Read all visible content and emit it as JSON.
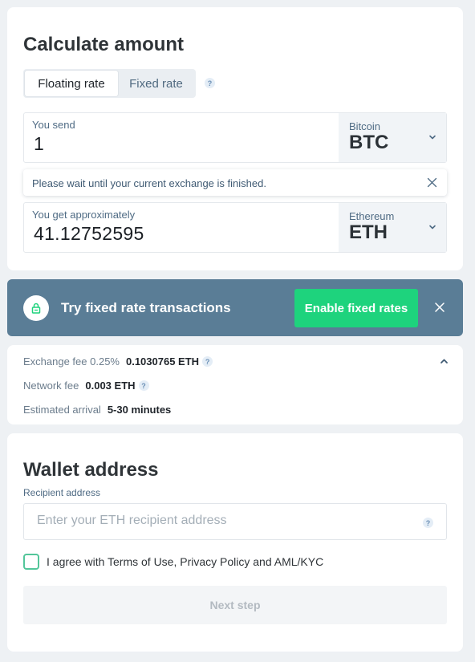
{
  "calculate": {
    "title": "Calculate amount",
    "tabs": [
      {
        "label": "Floating rate",
        "active": true
      },
      {
        "label": "Fixed rate",
        "active": false
      }
    ],
    "help_icon": "?",
    "send": {
      "label": "You send",
      "value": "1",
      "currency_name": "Bitcoin",
      "currency_code": "BTC"
    },
    "warning": "Please wait until your current exchange is finished.",
    "get": {
      "label": "You get approximately",
      "value": "41.12752595",
      "currency_name": "Ethereum",
      "currency_code": "ETH"
    }
  },
  "banner": {
    "text": "Try fixed rate transactions",
    "button_label": "Enable fixed rates",
    "icon": "lock-icon"
  },
  "fees": {
    "exchange_fee_label": "Exchange fee 0.25%",
    "exchange_fee_value": "0.1030765 ETH",
    "network_fee_label": "Network fee",
    "network_fee_value": "0.003 ETH",
    "arrival_label": "Estimated arrival",
    "arrival_value": "5-30 minutes"
  },
  "wallet": {
    "title": "Wallet address",
    "recipient_label": "Recipient address",
    "recipient_placeholder": "Enter your ETH recipient address",
    "recipient_value": "",
    "agree_text": "I agree with Terms of Use, Privacy Policy and AML/KYC",
    "agree_checked": false,
    "next_label": "Next step"
  },
  "colors": {
    "banner_bg": "#5a7d96",
    "accent_green": "#1ed37d",
    "checkbox_border": "#53c69a",
    "label_blue": "#4f6b84"
  }
}
